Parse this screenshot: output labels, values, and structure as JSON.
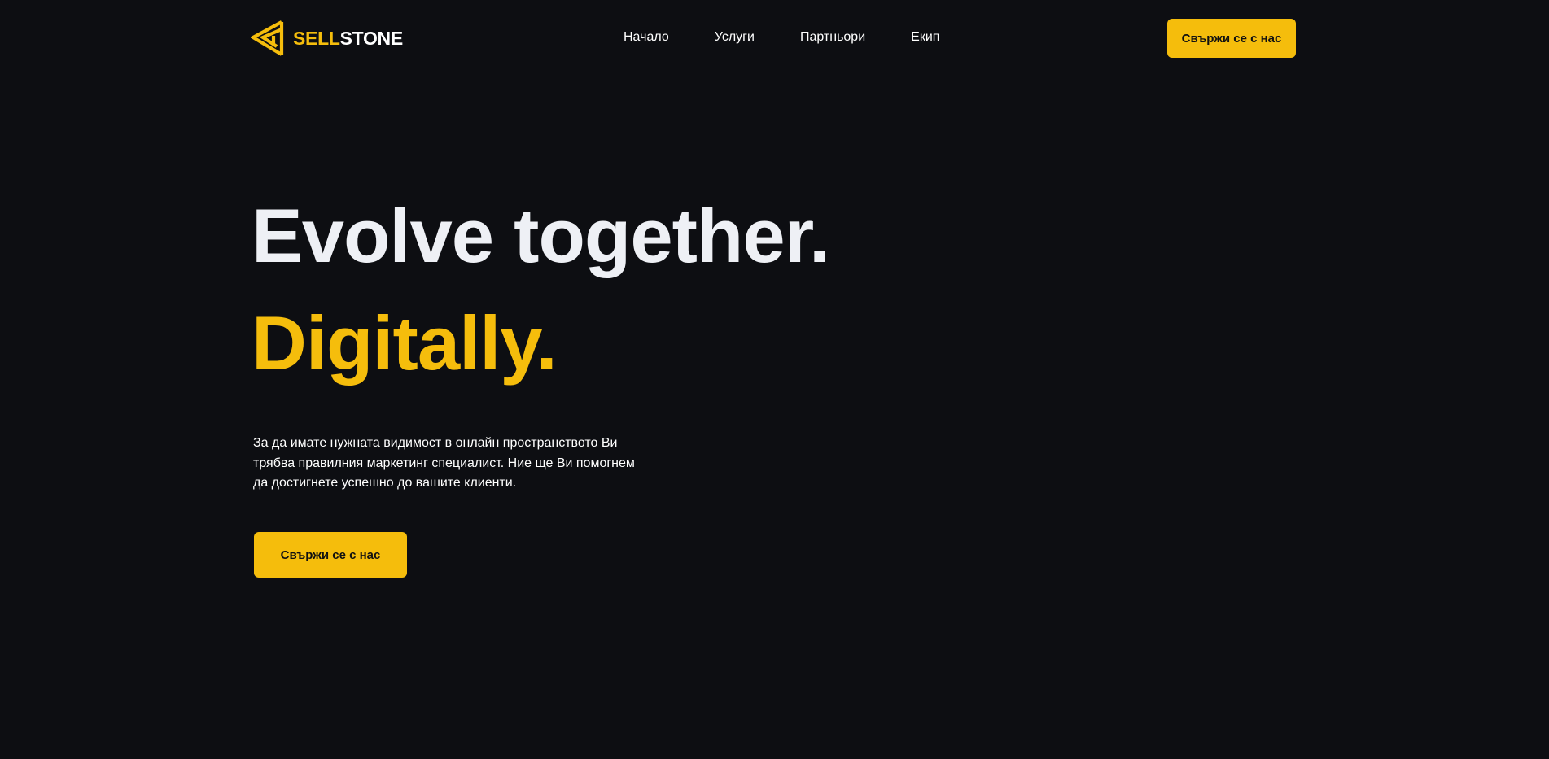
{
  "brand": {
    "name_part_1": "SELL",
    "name_part_2": "STONE",
    "logo_icon": "triangle-logo-icon",
    "accent_color": "#f5bd0c"
  },
  "nav": {
    "items": [
      {
        "label": "Начало"
      },
      {
        "label": "Услуги"
      },
      {
        "label": "Партньори"
      },
      {
        "label": "Екип"
      }
    ]
  },
  "header": {
    "cta_label": "Свържи се с нас"
  },
  "hero": {
    "title_line_1": "Evolve together.",
    "title_line_2": "Digitally.",
    "description_lines": [
      "За да имате нужната видимост в онлайн пространството Ви",
      "трябва правилния маркетинг специалист. Ние ще Ви помогнем",
      "да достигнете успешно до вашите клиенти."
    ],
    "cta_label": "Свържи се с нас"
  },
  "colors": {
    "background": "#0d0e12",
    "accent": "#f5bd0c",
    "text": "#ffffff"
  }
}
